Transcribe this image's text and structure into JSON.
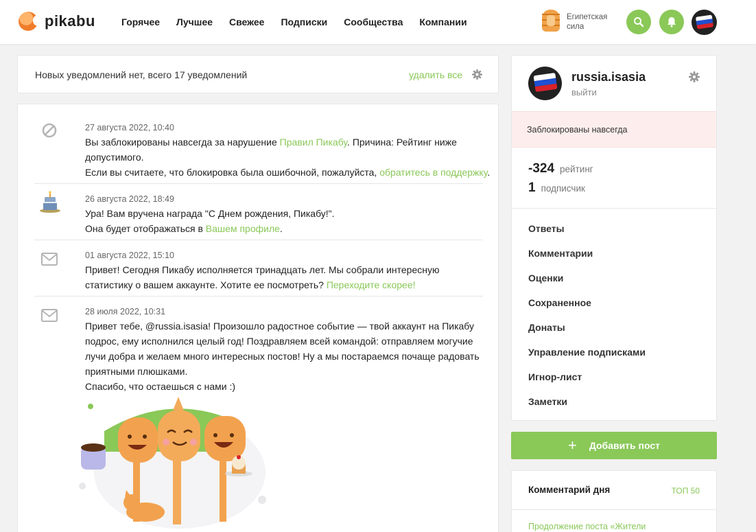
{
  "header": {
    "logo_text": "pikabu",
    "nav": [
      "Горячее",
      "Лучшее",
      "Свежее",
      "Подписки",
      "Сообщества",
      "Компании"
    ],
    "badge_label_line1": "Египетская",
    "badge_label_line2": "сила",
    "accent": "#8ac858"
  },
  "notifications": {
    "summary": "Новых уведомлений нет, всего 17 уведомлений",
    "delete_all": "удалить все",
    "items": [
      {
        "icon": "ban-icon",
        "date": "27 августа 2022, 10:40",
        "line1_a": "Вы заблокированы навсегда за нарушение ",
        "line1_link": "Правил Пикабу",
        "line1_b": ". Причина: Рейтинг ниже допустимого.",
        "line2_a": "Если вы считаете, что блокировка была ошибочной, пожалуйста, ",
        "line2_link": "обратитесь в поддержку",
        "line2_b": "."
      },
      {
        "icon": "birthday-cake-icon",
        "date": "26 августа 2022, 18:49",
        "line1": "Ура! Вам вручена награда \"С Днем рождения, Пикабу!\".",
        "line2_a": "Она будет отображаться в ",
        "line2_link": "Вашем профиле",
        "line2_b": "."
      },
      {
        "icon": "envelope-icon",
        "date": "01 августа 2022, 15:10",
        "text_a": "Привет! Сегодня Пикабу исполняется тринадцать лет. Мы собрали интересную статистику о вашем аккаунте. Хотите ее посмотреть? ",
        "text_link": "Переходите скорее!"
      },
      {
        "icon": "envelope-icon",
        "date": "28 июля 2022, 10:31",
        "text": "Привет тебе, @russia.isasia! Произошло радостное событие — твой аккаунт на Пикабу подрос, ему исполнился целый год! Поздравляем всей командой: отправляем могучие лучи добра и желаем много интересных постов! Ну а мы постараемся почаще радовать приятными плюшками.",
        "text2": "Спасибо, что остаешься с нами :)"
      }
    ]
  },
  "profile": {
    "username": "russia.isasia",
    "logout": "выйти",
    "banned": "Заблокированы навсегда",
    "rating_value": "-324",
    "rating_label": "рейтинг",
    "subs_value": "1",
    "subs_label": "подписчик",
    "menu": [
      "Ответы",
      "Комментарии",
      "Оценки",
      "Сохраненное",
      "Донаты",
      "Управление подписками",
      "Игнор-лист",
      "Заметки"
    ]
  },
  "add_post": "Добавить пост",
  "comment_of_day": {
    "title": "Комментарий дня",
    "top": "ТОП 50",
    "link": "Продолжение поста «Жители"
  }
}
